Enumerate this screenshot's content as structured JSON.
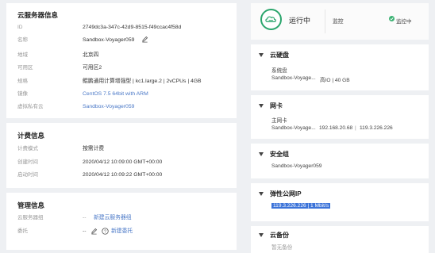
{
  "server_info": {
    "title": "云服务器信息",
    "rows": [
      {
        "label": "ID",
        "value": "2749dc3a-347c-42d9-8515-f49ccac4f58d"
      },
      {
        "label": "名称",
        "value": "Sandbox-Voyager059"
      },
      {
        "label": "地域",
        "value": "北京四"
      },
      {
        "label": "可用区",
        "value": "可用区2"
      },
      {
        "label": "规格",
        "value": "鲲鹏通用计算增强型 | kc1.large.2 | 2vCPUs | 4GB"
      },
      {
        "label": "镜像",
        "value": "CentOS 7.5 64bit with ARM"
      },
      {
        "label": "虚拟私有云",
        "value": "Sandbox-Voyager059"
      }
    ]
  },
  "billing": {
    "title": "计费信息",
    "rows": [
      {
        "label": "计费模式",
        "value": "按需计费"
      },
      {
        "label": "创建时间",
        "value": "2020/04/12 10:09:00 GMT+00:00"
      },
      {
        "label": "启动时间",
        "value": "2020/04/12 10:09:22 GMT+00:00"
      }
    ]
  },
  "management": {
    "title": "管理信息",
    "group_label": "云服务器组",
    "group_dash": "--",
    "group_link": "新建云服务器组",
    "delegate_label": "委托",
    "delegate_dash": "--",
    "delegate_link": "新建委托"
  },
  "status": {
    "state": "运行中",
    "monitor_label": "监控",
    "monitor_status": "监控中",
    "accent": "#2aa56c"
  },
  "disk": {
    "title": "云硬盘",
    "sub": "系统盘",
    "name": "Sandbox-Voyage...",
    "detail": "高IO | 40 GB"
  },
  "nic": {
    "title": "网卡",
    "sub": "主网卡",
    "name": "Sandbox-Voyage...",
    "ip": "192.168.20.68",
    "sep": "|",
    "eip": "119.3.226.226"
  },
  "security_group": {
    "title": "安全组",
    "value": "Sandbox-Voyager059"
  },
  "eip": {
    "title": "弹性公网IP",
    "value": "119.3.226.226 | 1 Mbit/s"
  },
  "backup": {
    "title": "云备份",
    "value": "暂无备份"
  }
}
